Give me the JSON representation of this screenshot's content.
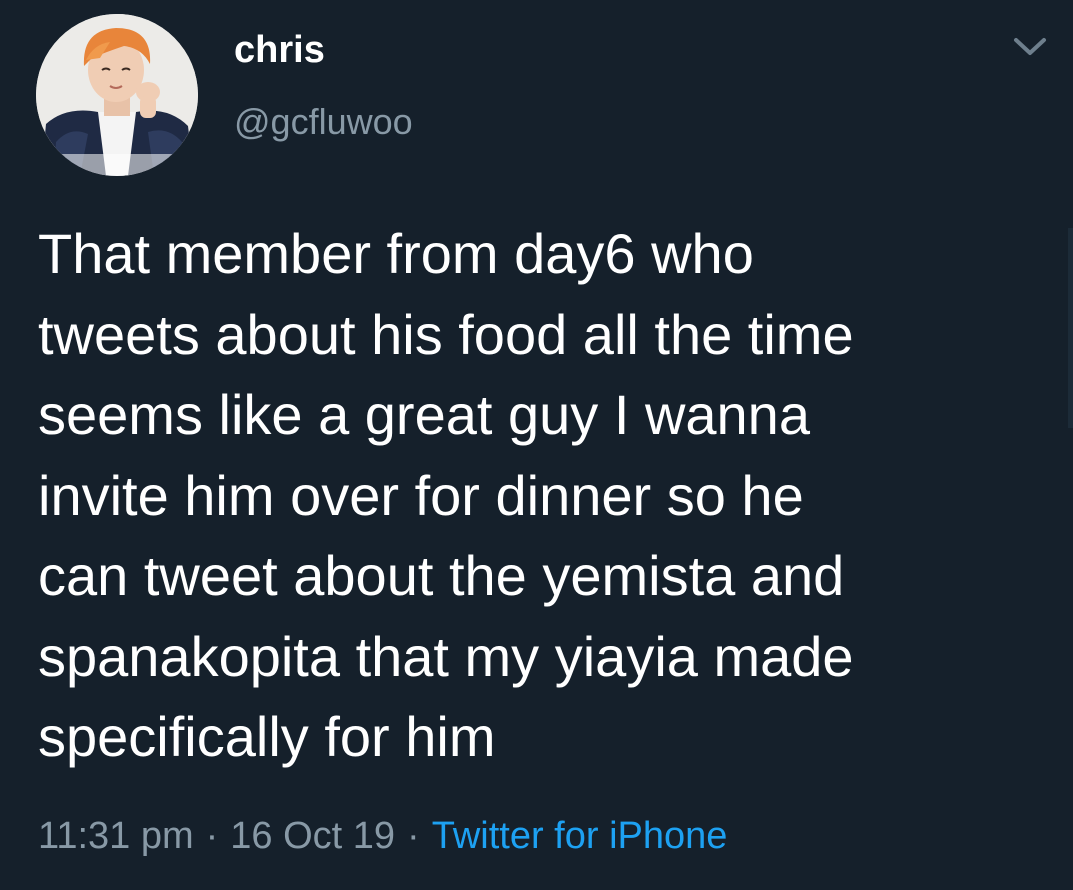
{
  "colors": {
    "background": "#15202b",
    "primary_text": "#ffffff",
    "secondary_text": "#8899a6",
    "link": "#1da1f2"
  },
  "author": {
    "display_name": "chris",
    "handle": "@gcfluwoo",
    "avatar_icon": "profile-photo"
  },
  "menu_icon": "chevron-down-icon",
  "tweet": {
    "lines": [
      "That member from day6 who",
      "tweets about his food all the time",
      "seems like a great guy I wanna",
      "invite him over for dinner so he",
      "can tweet about the yemista and",
      "spanakopita that my yiayia made",
      "specifically for him"
    ],
    "time": "11:31 pm",
    "date": "16 Oct 19",
    "separator": "·",
    "source": "Twitter for iPhone"
  }
}
